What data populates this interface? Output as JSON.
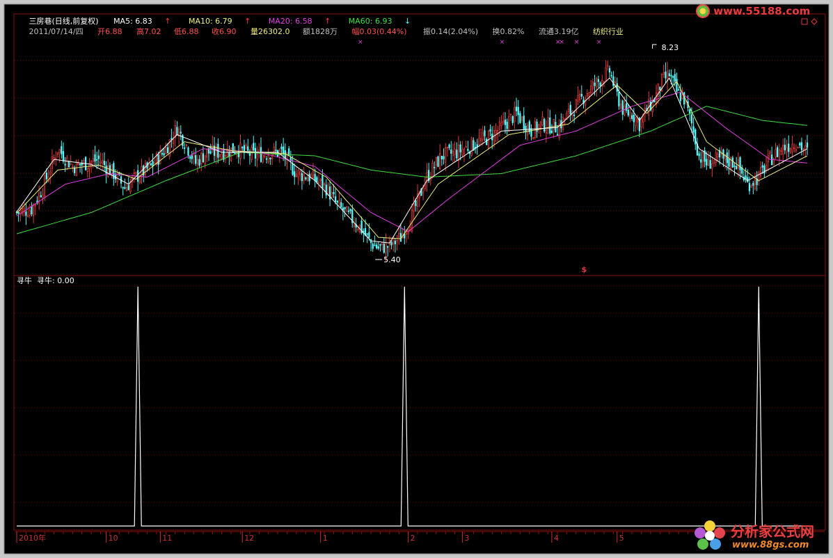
{
  "header": {
    "stock_name": "三房巷(日线,前复权)",
    "ma5": "MA5: 6.83",
    "ma10": "MA10: 6.79",
    "ma20": "MA20: 6.58",
    "ma60": "MA60: 6.93",
    "info_date": "2011/07/14/四",
    "open": "开6.88",
    "high": "高7.02",
    "low": "低6.88",
    "close": "收6.90",
    "volume": "量26302.0",
    "amount": "额1828万",
    "change": "幅0.03(0.44%)",
    "amplitude": "振0.14(2.04%)",
    "turnover": "换0.82%",
    "float": "流通3.19亿",
    "industry": "纺织行业"
  },
  "watermark_top": "www.55188.com",
  "watermark_bottom": {
    "brand": "分析家公式网",
    "url": "www.88gs.com"
  },
  "indicator_label": "寻牛  寻牛: 0.00",
  "signal_mark": "$",
  "annotations": {
    "high_label": "8.23",
    "low_label": "5.40"
  },
  "x_axis_labels": [
    "2010年",
    "10",
    "11",
    "12",
    "1",
    "2",
    "3",
    "4",
    "5"
  ],
  "colors": {
    "up": "#e03a3a",
    "down": "#54fcfc",
    "ma5": "#ffffff",
    "ma10": "#f0f080",
    "ma20": "#e040e0",
    "ma60": "#40e040",
    "grid": "#7a1010",
    "axis_text": "#c83232"
  },
  "chart_data": [
    {
      "type": "candlestick",
      "title": "三房巷(日线,前复权)",
      "ylim": [
        5.2,
        8.5
      ],
      "price_path": [
        [
          0,
          6.05
        ],
        [
          8,
          6.1
        ],
        [
          14,
          6.4
        ],
        [
          22,
          6.95
        ],
        [
          30,
          6.7
        ],
        [
          38,
          6.75
        ],
        [
          44,
          6.8
        ],
        [
          52,
          6.6
        ],
        [
          58,
          6.4
        ],
        [
          64,
          6.55
        ],
        [
          72,
          6.7
        ],
        [
          80,
          6.95
        ],
        [
          86,
          7.25
        ],
        [
          90,
          7.05
        ],
        [
          96,
          6.75
        ],
        [
          102,
          6.9
        ],
        [
          110,
          6.9
        ],
        [
          118,
          6.95
        ],
        [
          128,
          6.85
        ],
        [
          136,
          6.9
        ],
        [
          142,
          6.9
        ],
        [
          150,
          6.6
        ],
        [
          158,
          6.55
        ],
        [
          166,
          6.4
        ],
        [
          172,
          6.15
        ],
        [
          178,
          6.0
        ],
        [
          184,
          5.85
        ],
        [
          190,
          5.62
        ],
        [
          194,
          5.55
        ],
        [
          200,
          5.58
        ],
        [
          206,
          5.7
        ],
        [
          212,
          6.0
        ],
        [
          220,
          6.55
        ],
        [
          228,
          6.85
        ],
        [
          236,
          6.9
        ],
        [
          244,
          7.0
        ],
        [
          252,
          7.1
        ],
        [
          260,
          7.25
        ],
        [
          268,
          7.45
        ],
        [
          276,
          7.2
        ],
        [
          282,
          7.3
        ],
        [
          290,
          7.25
        ],
        [
          298,
          7.5
        ],
        [
          306,
          7.75
        ],
        [
          312,
          7.9
        ],
        [
          318,
          8.05
        ],
        [
          322,
          7.7
        ],
        [
          326,
          7.45
        ],
        [
          330,
          7.45
        ],
        [
          334,
          7.3
        ],
        [
          338,
          7.5
        ],
        [
          342,
          7.65
        ],
        [
          346,
          7.9
        ],
        [
          350,
          8.0
        ],
        [
          354,
          7.75
        ],
        [
          358,
          7.65
        ],
        [
          362,
          7.3
        ],
        [
          366,
          6.85
        ],
        [
          370,
          6.75
        ],
        [
          378,
          6.8
        ],
        [
          386,
          6.75
        ],
        [
          392,
          6.45
        ],
        [
          398,
          6.55
        ],
        [
          404,
          6.8
        ],
        [
          410,
          6.95
        ],
        [
          418,
          7.05
        ],
        [
          424,
          6.9
        ]
      ],
      "ma5_path": [
        [
          0,
          6.06
        ],
        [
          20,
          6.8
        ],
        [
          40,
          6.73
        ],
        [
          60,
          6.45
        ],
        [
          86,
          7.15
        ],
        [
          110,
          6.9
        ],
        [
          140,
          6.9
        ],
        [
          160,
          6.5
        ],
        [
          190,
          5.65
        ],
        [
          200,
          5.62
        ],
        [
          220,
          6.5
        ],
        [
          260,
          7.2
        ],
        [
          290,
          7.25
        ],
        [
          318,
          7.95
        ],
        [
          334,
          7.35
        ],
        [
          350,
          7.95
        ],
        [
          366,
          6.95
        ],
        [
          392,
          6.5
        ],
        [
          424,
          6.95
        ]
      ],
      "ma10_path": [
        [
          0,
          6.04
        ],
        [
          22,
          6.65
        ],
        [
          44,
          6.72
        ],
        [
          64,
          6.52
        ],
        [
          90,
          7.05
        ],
        [
          116,
          6.92
        ],
        [
          144,
          6.88
        ],
        [
          166,
          6.55
        ],
        [
          194,
          5.7
        ],
        [
          206,
          5.68
        ],
        [
          226,
          6.45
        ],
        [
          264,
          7.15
        ],
        [
          296,
          7.3
        ],
        [
          322,
          7.85
        ],
        [
          338,
          7.45
        ],
        [
          354,
          7.9
        ],
        [
          370,
          7.05
        ],
        [
          398,
          6.5
        ],
        [
          424,
          6.85
        ]
      ],
      "ma20_path": [
        [
          0,
          6.0
        ],
        [
          26,
          6.45
        ],
        [
          50,
          6.6
        ],
        [
          70,
          6.55
        ],
        [
          100,
          6.95
        ],
        [
          130,
          6.9
        ],
        [
          160,
          6.7
        ],
        [
          190,
          6.05
        ],
        [
          210,
          5.78
        ],
        [
          232,
          6.25
        ],
        [
          270,
          7.0
        ],
        [
          300,
          7.2
        ],
        [
          330,
          7.55
        ],
        [
          356,
          7.75
        ],
        [
          380,
          7.25
        ],
        [
          404,
          6.8
        ],
        [
          424,
          6.75
        ]
      ],
      "ma60_path": [
        [
          0,
          5.75
        ],
        [
          40,
          6.05
        ],
        [
          80,
          6.5
        ],
        [
          120,
          6.9
        ],
        [
          160,
          6.85
        ],
        [
          190,
          6.65
        ],
        [
          220,
          6.55
        ],
        [
          260,
          6.6
        ],
        [
          300,
          6.85
        ],
        [
          340,
          7.2
        ],
        [
          370,
          7.55
        ],
        [
          400,
          7.35
        ],
        [
          424,
          7.28
        ]
      ],
      "signal_x": [
        184,
        260,
        290,
        292,
        300,
        312
      ],
      "sell_signal_x": [
        304
      ],
      "high_label_x": 341,
      "low_label_x": 196
    },
    {
      "type": "line",
      "title": "寻牛",
      "ylim": [
        0,
        1
      ],
      "pulses": [
        {
          "x": 65,
          "value": 1
        },
        {
          "x": 208,
          "value": 1
        },
        {
          "x": 398,
          "value": 1
        }
      ],
      "n": 425
    }
  ]
}
